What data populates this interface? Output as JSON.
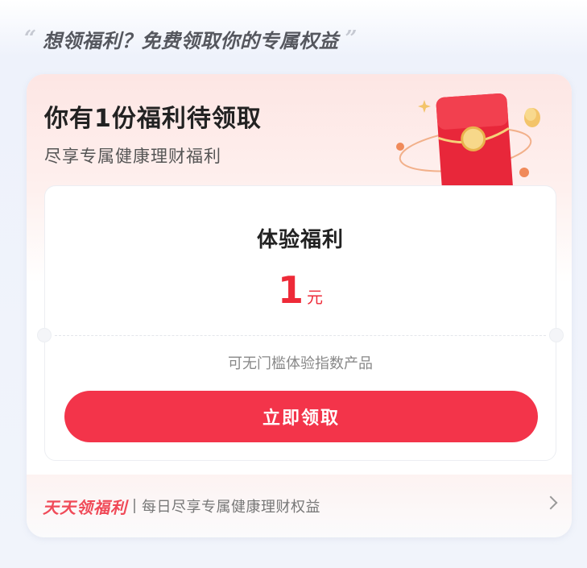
{
  "heading": {
    "quote_open": "“",
    "text": "想领福利？免费领取你的专属权益",
    "quote_close": "”"
  },
  "card": {
    "title": "你有1份福利待领取",
    "subtitle": "尽享专属健康理财福利",
    "benefit": {
      "name": "体验福利",
      "amount": "1",
      "unit": "元",
      "description": "可无门槛体验指数产品",
      "button_label": "立即领取"
    },
    "footer": {
      "brand": "天天领福利",
      "text": "每日尽享专属健康理财权益",
      "icon": "chevron-right-icon"
    }
  },
  "colors": {
    "accent": "#f3344a",
    "amount": "#ee2a38",
    "brand_text": "#f04a58"
  }
}
